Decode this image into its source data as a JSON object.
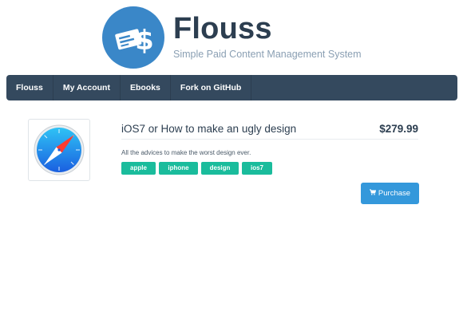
{
  "brand": {
    "title": "Flouss",
    "subtitle": "Simple Paid Content Management System"
  },
  "nav": {
    "items": [
      {
        "label": "Flouss"
      },
      {
        "label": "My Account"
      },
      {
        "label": "Ebooks"
      },
      {
        "label": "Fork on GitHub"
      }
    ]
  },
  "ebook": {
    "title": "iOS7 or How to make an ugly design",
    "price": "$279.99",
    "description": "All the advices to make the worst design ever.",
    "tags": [
      "apple",
      "iphone",
      "design",
      "ios7"
    ],
    "purchase_label": "Purchase",
    "thumbnail_icon": "safari-compass-icon"
  },
  "colors": {
    "nav_bg": "#34495e",
    "logo_blue": "#3a87c8",
    "tag_green": "#1abc9c",
    "button_blue": "#3498db",
    "text_dark": "#2c3e50"
  }
}
